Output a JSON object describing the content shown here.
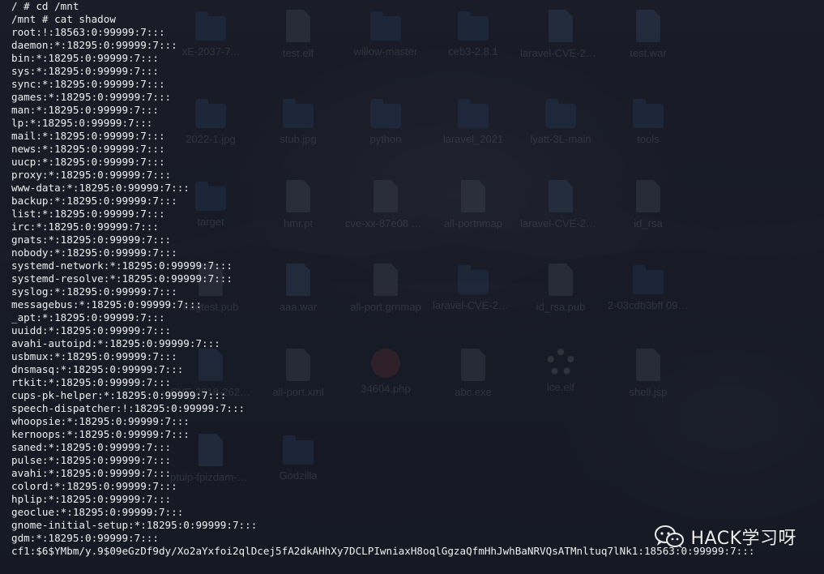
{
  "desktop": {
    "icons": [
      {
        "label": "xE-2037-7...",
        "kind": "folder"
      },
      {
        "label": "test.elf",
        "kind": "file"
      },
      {
        "label": "willow-master",
        "kind": "folder"
      },
      {
        "label": "ceb3-2.8.1",
        "kind": "folder"
      },
      {
        "label": "laravel-CVE-2021-...",
        "kind": "zip"
      },
      {
        "label": "test.war",
        "kind": "zip"
      },
      {
        "label": "2022-1.jpg",
        "kind": "folder"
      },
      {
        "label": "stub.jpg",
        "kind": "folder"
      },
      {
        "label": "python",
        "kind": "folder"
      },
      {
        "label": "laravel_2021",
        "kind": "folder"
      },
      {
        "label": "lyatt-3L-main",
        "kind": "folder"
      },
      {
        "label": "tools",
        "kind": "folder"
      },
      {
        "label": "target",
        "kind": "folder"
      },
      {
        "label": "hmr.pt",
        "kind": "file"
      },
      {
        "label": "cve-xx-87e08 bb-harvest",
        "kind": "file"
      },
      {
        "label": "all-portnmap",
        "kind": "file"
      },
      {
        "label": "laravel-CVE-2021...",
        "kind": "zip"
      },
      {
        "label": "id_rsa",
        "kind": "file"
      },
      {
        "label": "fragtest.pub",
        "kind": "file"
      },
      {
        "label": "aaa.war",
        "kind": "zip"
      },
      {
        "label": "all-port.grnmap",
        "kind": "file"
      },
      {
        "label": "laravel-CVE-2021...",
        "kind": "folder"
      },
      {
        "label": "id_rsa.pub",
        "kind": "file"
      },
      {
        "label": "2-03cdb3bff 090e9888...",
        "kind": "folder"
      },
      {
        "label": "CVE-2018-2628.py",
        "kind": "py"
      },
      {
        "label": "all-port.xml",
        "kind": "file"
      },
      {
        "label": "34604.php",
        "kind": "php"
      },
      {
        "label": "abc.exe",
        "kind": "file"
      },
      {
        "label": "ice.elf",
        "kind": "gear"
      },
      {
        "label": "shell.jsp",
        "kind": "file"
      },
      {
        "label": "ptuip-fpizdam-ma...",
        "kind": "zip"
      },
      {
        "label": "Godzilla",
        "kind": "folder"
      }
    ]
  },
  "terminal": {
    "lines": [
      "/ # cd /mnt",
      "/mnt # cat shadow",
      "root:!:18563:0:99999:7:::",
      "daemon:*:18295:0:99999:7:::",
      "bin:*:18295:0:99999:7:::",
      "sys:*:18295:0:99999:7:::",
      "sync:*:18295:0:99999:7:::",
      "games:*:18295:0:99999:7:::",
      "man:*:18295:0:99999:7:::",
      "lp:*:18295:0:99999:7:::",
      "mail:*:18295:0:99999:7:::",
      "news:*:18295:0:99999:7:::",
      "uucp:*:18295:0:99999:7:::",
      "proxy:*:18295:0:99999:7:::",
      "www-data:*:18295:0:99999:7:::",
      "backup:*:18295:0:99999:7:::",
      "list:*:18295:0:99999:7:::",
      "irc:*:18295:0:99999:7:::",
      "gnats:*:18295:0:99999:7:::",
      "nobody:*:18295:0:99999:7:::",
      "systemd-network:*:18295:0:99999:7:::",
      "systemd-resolve:*:18295:0:99999:7:::",
      "syslog:*:18295:0:99999:7:::",
      "messagebus:*:18295:0:99999:7:::",
      "_apt:*:18295:0:99999:7:::",
      "uuidd:*:18295:0:99999:7:::",
      "avahi-autoipd:*:18295:0:99999:7:::",
      "usbmux:*:18295:0:99999:7:::",
      "dnsmasq:*:18295:0:99999:7:::",
      "rtkit:*:18295:0:99999:7:::",
      "cups-pk-helper:*:18295:0:99999:7:::",
      "speech-dispatcher:!:18295:0:99999:7:::",
      "whoopsie:*:18295:0:99999:7:::",
      "kernoops:*:18295:0:99999:7:::",
      "saned:*:18295:0:99999:7:::",
      "pulse:*:18295:0:99999:7:::",
      "avahi:*:18295:0:99999:7:::",
      "colord:*:18295:0:99999:7:::",
      "hplip:*:18295:0:99999:7:::",
      "geoclue:*:18295:0:99999:7:::",
      "gnome-initial-setup:*:18295:0:99999:7:::",
      "gdm:*:18295:0:99999:7:::",
      "cf1:$6$YMbm/y.9$09eGzDf9dy/Xo2aYxfoi2qlDcej5fA2dkAHhXy7DCLPIwniaxH8oqlGgzaQfmHhJwhBaNRVQsATMnltuq7lNk1:18563:0:99999:7:::"
    ]
  },
  "watermark": {
    "text": "HACK学习呀",
    "icon": "wechat-icon"
  }
}
